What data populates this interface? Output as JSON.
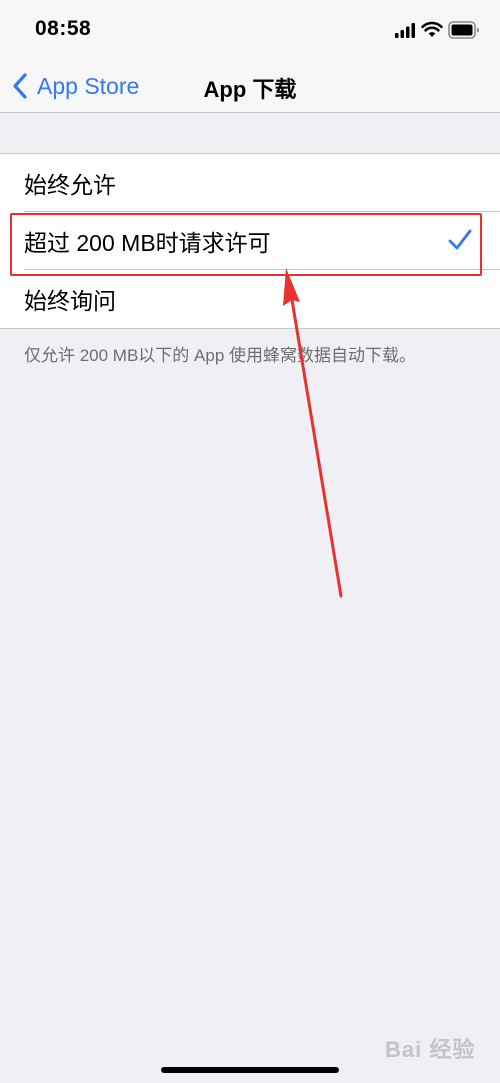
{
  "status_bar": {
    "time": "08:58",
    "icons": [
      "signal-icon",
      "wifi-icon",
      "battery-icon"
    ]
  },
  "nav": {
    "back_label": "App Store",
    "title": "App 下载"
  },
  "options": [
    {
      "label": "始终允许",
      "selected": false
    },
    {
      "label": "超过 200 MB时请求许可",
      "selected": true
    },
    {
      "label": "始终询问",
      "selected": false
    }
  ],
  "footer_note": "仅允许 200 MB以下的 App 使用蜂窝数据自动下载。",
  "watermark": "Bai 经验",
  "colors": {
    "accent": "#3478f6",
    "annotation": "#e8322f",
    "background": "#efeff4"
  }
}
